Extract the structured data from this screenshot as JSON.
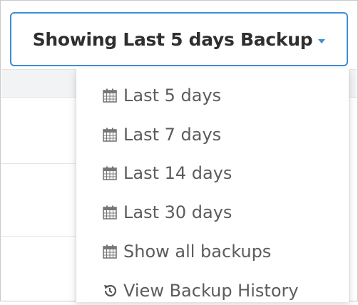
{
  "toggle": {
    "label": "Showing Last 5 days Backup",
    "caret_icon": "caret-down-icon"
  },
  "menu": {
    "items": [
      {
        "label": "Last 5 days",
        "icon": "calendar-icon"
      },
      {
        "label": "Last 7 days",
        "icon": "calendar-icon"
      },
      {
        "label": "Last 14 days",
        "icon": "calendar-icon"
      },
      {
        "label": "Last 30 days",
        "icon": "calendar-icon"
      },
      {
        "label": "Show all backups",
        "icon": "calendar-icon"
      },
      {
        "label": "View Backup History",
        "icon": "history-icon"
      }
    ]
  },
  "colors": {
    "accent": "#3a8fd6",
    "text_dark": "#2f2f2f",
    "text_menu": "#5c5c5c",
    "icon_gray": "#777777"
  }
}
